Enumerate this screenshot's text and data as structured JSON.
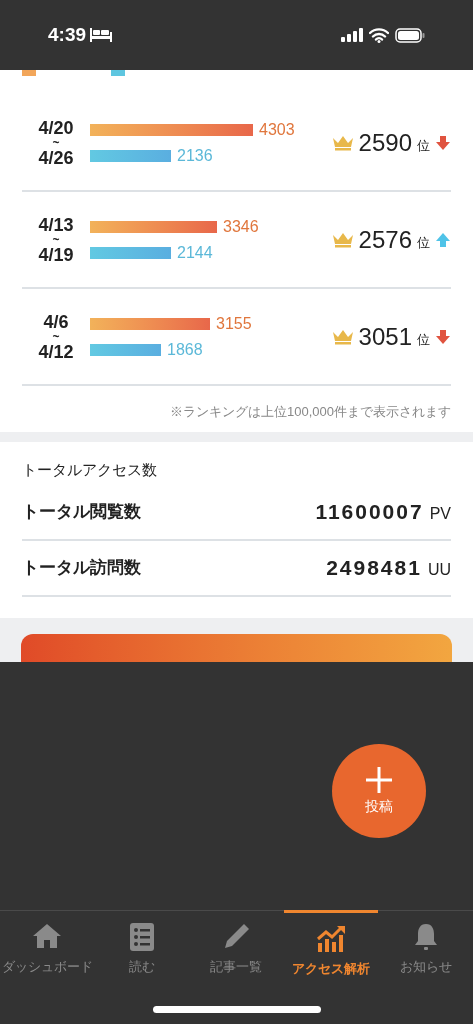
{
  "status_bar": {
    "time": "4:39"
  },
  "weeks": [
    {
      "from": "4/20",
      "sep": "~",
      "to": "4/26",
      "pv": "4303",
      "uu": "2136",
      "rank": "2590",
      "rank_unit": "位",
      "rank_up": false
    },
    {
      "from": "4/13",
      "sep": "~",
      "to": "4/19",
      "pv": "3346",
      "uu": "2144",
      "rank": "2576",
      "rank_unit": "位",
      "rank_up": true
    },
    {
      "from": "4/6",
      "sep": "~",
      "to": "4/12",
      "pv": "3155",
      "uu": "1868",
      "rank": "3051",
      "rank_unit": "位",
      "rank_up": false
    }
  ],
  "ranking_note": "※ランキングは上位100,000件まで表示されます",
  "totals": {
    "title": "トータルアクセス数",
    "rows": [
      {
        "label": "トータル閲覧数",
        "value": "11600007",
        "unit": "PV"
      },
      {
        "label": "トータル訪問数",
        "value": "2498481",
        "unit": "UU"
      }
    ]
  },
  "fab": {
    "label": "投稿"
  },
  "tabs": [
    {
      "kind": "home",
      "label": "ダッシュボード",
      "selected": false
    },
    {
      "kind": "list",
      "label": "読む",
      "selected": false
    },
    {
      "kind": "pencil",
      "label": "記事一覧",
      "selected": false
    },
    {
      "kind": "chart",
      "label": "アクセス解析",
      "selected": true
    },
    {
      "kind": "bell",
      "label": "お知らせ",
      "selected": false
    }
  ]
}
